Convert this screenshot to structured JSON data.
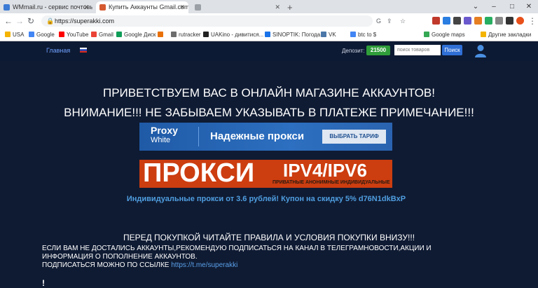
{
  "browser": {
    "tabs": [
      {
        "title": "WMmail.ru - сервис почтовых ра",
        "favicon_color": "#3b7bd5"
      },
      {
        "title": "Купить Аккаунты Gmail.com/",
        "favicon_color": "#d65a31"
      },
      {
        "title": "",
        "favicon_color": "#9aa0a6"
      }
    ],
    "new_tab": "+",
    "window_controls": [
      "⌄",
      "–",
      "□",
      "✕"
    ],
    "url": "https://superakki.com",
    "bookmarks": [
      {
        "label": "USA",
        "color": "#f4b400"
      },
      {
        "label": "Google",
        "color": "#4285f4"
      },
      {
        "label": "YouTube",
        "color": "#ff0000"
      },
      {
        "label": "Gmail",
        "color": "#ea4335"
      },
      {
        "label": "Google Диск",
        "color": "#0f9d58"
      },
      {
        "label": "",
        "color": "#e8710a"
      },
      {
        "label": "rutracker",
        "color": "#6d6d6d"
      },
      {
        "label": "UAKino - дивитися...",
        "color": "#222222"
      },
      {
        "label": "SINOPTIK: Погода...",
        "color": "#1a73e8"
      },
      {
        "label": "VK",
        "color": "#4a76a8"
      },
      {
        "label": "btc to $",
        "color": "#4285f4"
      },
      {
        "label": "Google maps",
        "color": "#34a853"
      },
      {
        "label": "Другие закладки",
        "color": "#f4b400"
      }
    ]
  },
  "header": {
    "home": "Главная",
    "deposit_label": "Депозит:",
    "deposit_value": "21500",
    "search_placeholder": "поиск товаров",
    "search_button": "Поиск"
  },
  "main": {
    "welcome": "ПРИВЕТСТВУЕМ ВАС В ОНЛАЙН МАГАЗИНЕ АККАУНТОВ!",
    "attention": "ВНИМАНИЕ!!! НЕ ЗАБЫВАЕМ УКАЗЫВАТЬ В ПЛАТЕЖЕ ПРИМЕЧАНИЕ!!!",
    "banner1": {
      "logo_top": "Proxy",
      "logo_bottom": "White",
      "text": "Надежные прокси",
      "button": "ВЫБРАТЬ ТАРИФ"
    },
    "banner2": {
      "big": "ПРОКСИ",
      "ipv": "IPV4/IPV6",
      "sub": "ПРИВАТНЫЕ АНОНИМНЫЕ ИНДИВИДУАЛЬНЫЕ"
    },
    "promo": "Индивидуальные прокси от 3.6 рублей! Купон на скидку 5% d76N1dkBxP",
    "rules_title": "ПЕРЕД ПОКУПКОЙ ЧИТАЙТЕ ПРАВИЛА И УСЛОВИЯ ПОКУПКИ ВНИЗУ!!!",
    "notice": "ЕСЛИ ВАМ НЕ ДОСТАЛИСЬ АККАУНТЫ,РЕКОМЕНДУЮ ПОДПИСАТЬСЯ НА КАНАЛ В ТЕЛЕГРАМНОВОСТИ,АКЦИИ И ИНФОРМАЦИЯ О ПОПОЛНЕНИЕ АККАУНТОВ.",
    "subscribe_text": "ПОДПИСАТЬСЯ МОЖНО ПО ССЫЛКЕ",
    "subscribe_link": "https://t.me/superakki",
    "excl": "!"
  }
}
